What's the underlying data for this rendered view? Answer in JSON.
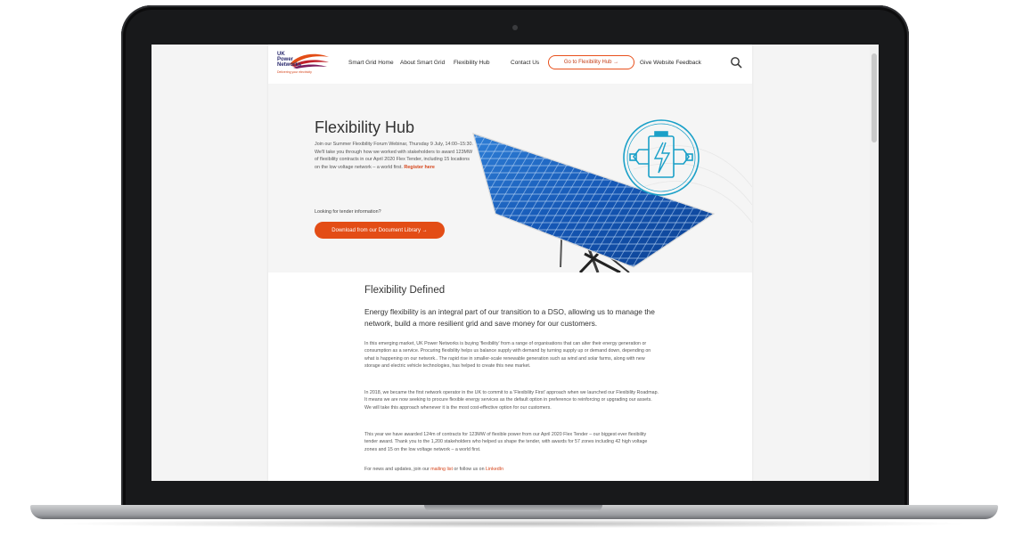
{
  "header": {
    "logo": {
      "line1": "UK",
      "line2": "Power",
      "line3": "Networks",
      "tagline": "Delivering your electricity"
    },
    "nav": [
      "Smart Grid Home",
      "About Smart Grid",
      "Flexibility Hub",
      "Contact Us"
    ],
    "cta_label": "Go to Flexibility Hub →",
    "feedback_label": "Give Website Feedback"
  },
  "hero": {
    "title": "Flexibility Hub",
    "text": "Join our Summer Flexibility Forum Webinar, Thursday 9 July, 14:00–15:30. We'll take you through how we worked with stakeholders to award 123MW of flexibility contracts in our April 2020 Flex Tender, including 15 locations on the low voltage network – a world first.",
    "register_label": "Register here",
    "tender_question": "Looking for tender information?",
    "doc_button_label": "Download from our Document Library →"
  },
  "section": {
    "title": "Flexibility Defined",
    "lead": "Energy flexibility is an integral part of our transition to a DSO, allowing us to manage the network, build a more resilient grid and save money for our customers.",
    "p1": "In this emerging market, UK Power Networks is buying 'flexibility' from a range of organisations that can alter their energy generation or consumption as a service. Procuring flexibility helps us balance supply with demand by turning supply up or demand down, depending on what is happening on our network.. The rapid rise in smaller-scale renewable generation such as wind and solar farms, along with new storage and electric vehicle technologies, has helped to create this new market.",
    "p2": "In 2018, we became the first network operator in the UK to commit to a 'Flexibility First' approach when we launched our Flexibility Roadmap. It means we are now seeking to procure flexible energy services as the default option in preference to reinforcing or upgrading our assets. We will take this approach whenever it is the most cost-effective option for our customers.",
    "p3": "This year we have awarded 124m of contracts for 123MW of flexible power from our April 2020 Flex Tender – our biggest ever flexibility tender award. Thank you to the 1,200 stakeholders who helped us shape the tender, with awards for 57 zones including 42 high voltage zones and 15 on the low voltage network – a world first.",
    "p4_prefix": "For news and updates, join our ",
    "mailing_link": "mailing list",
    "p4_mid": " or follow us on ",
    "linkedin_link": "LinkedIn"
  },
  "colors": {
    "brand_orange": "#e34d16",
    "brand_navy": "#2a2a6e",
    "accent_teal": "#1aa0c8"
  }
}
